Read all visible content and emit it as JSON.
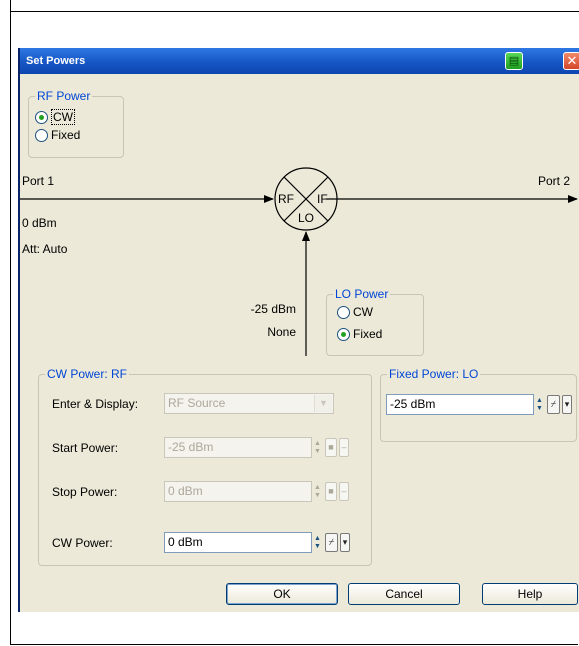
{
  "dialog": {
    "title": "Set Powers",
    "print_icon": "printer-icon",
    "close_glyph": "✕"
  },
  "rf_power": {
    "legend": "RF Power",
    "options": [
      {
        "label": "CW",
        "selected": true
      },
      {
        "label": "Fixed",
        "selected": false
      }
    ]
  },
  "diagram": {
    "port1_label": "Port 1",
    "port2_label": "Port 2",
    "port1_power": "0 dBm",
    "port1_att": "Att: Auto",
    "mixer_rf": "RF",
    "mixer_if": "IF",
    "mixer_lo": "LO",
    "lo_power_value": "-25 dBm",
    "lo_att": "None"
  },
  "lo_power": {
    "legend": "LO Power",
    "options": [
      {
        "label": "CW",
        "selected": false
      },
      {
        "label": "Fixed",
        "selected": true
      }
    ]
  },
  "cw_power_rf": {
    "legend": "CW Power: RF",
    "enter_display_label": "Enter & Display:",
    "enter_display_value": "RF Source",
    "start_power_label": "Start Power:",
    "start_power_value": "-25 dBm",
    "stop_power_label": "Stop Power:",
    "stop_power_value": "0 dBm",
    "cw_power_label": "CW Power:",
    "cw_power_value": "0 dBm"
  },
  "fixed_power_lo": {
    "legend": "Fixed Power: LO",
    "value": "-25 dBm"
  },
  "buttons": {
    "ok": "OK",
    "cancel": "Cancel",
    "help": "Help"
  },
  "colors": {
    "title_bar": "#1656c4",
    "dialog_bg": "#ece9d8",
    "legend_text": "#0046d5",
    "radio_dot": "#21a121"
  }
}
